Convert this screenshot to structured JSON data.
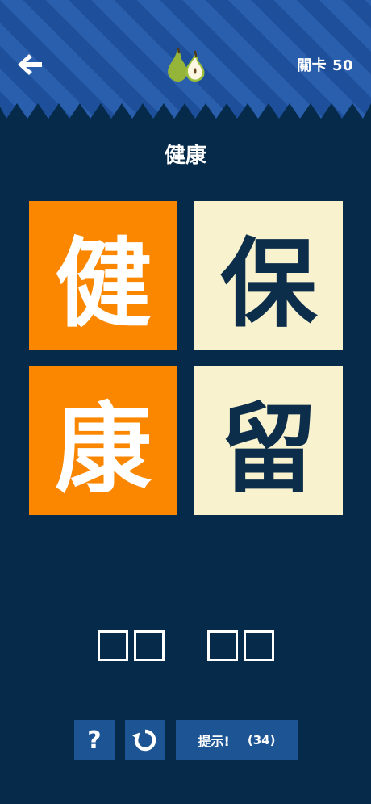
{
  "header": {
    "level_label": "關卡 50",
    "colors": {
      "band": "#1e4f9a",
      "band_stripe": "#2a5fae",
      "background": "#062a4a"
    }
  },
  "icons": {
    "back": "arrow-left-icon",
    "logo": "pear-icon",
    "reset": "refresh-icon"
  },
  "puzzle": {
    "title": "健康",
    "tiles": [
      {
        "char": "健",
        "selected": true
      },
      {
        "char": "保",
        "selected": false
      },
      {
        "char": "康",
        "selected": true
      },
      {
        "char": "留",
        "selected": false
      }
    ],
    "answer_slots": [
      "",
      "",
      "",
      ""
    ]
  },
  "colors": {
    "tile_selected": "#fb8700",
    "tile_unselected": "#f8f2cf",
    "tile_text_dark": "#0d2e4a",
    "button": "#1d5594"
  },
  "toolbar": {
    "help_label": "?",
    "hint_label": "提示!",
    "hint_count": "(34)"
  }
}
